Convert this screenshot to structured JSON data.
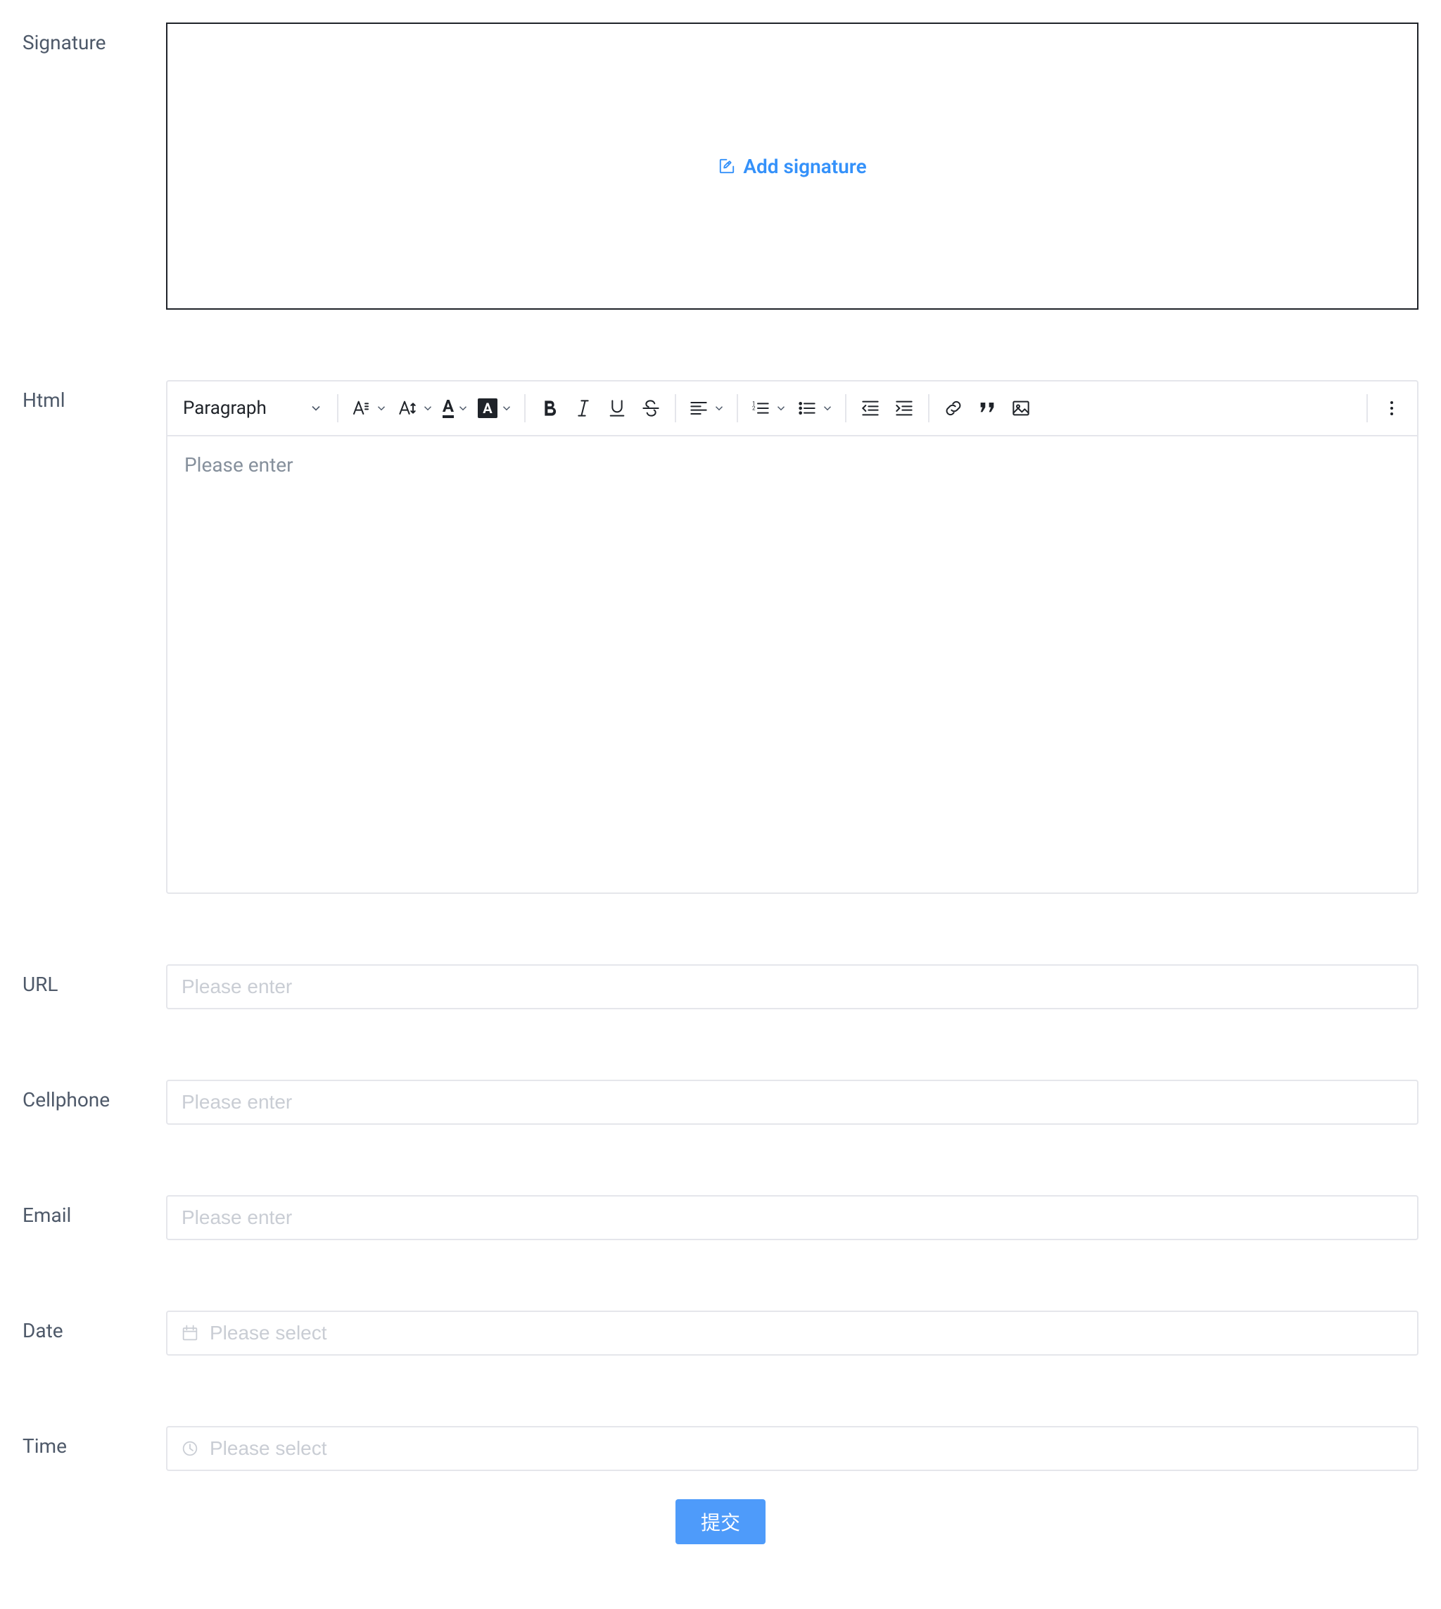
{
  "labels": {
    "signature": "Signature",
    "html": "Html",
    "url": "URL",
    "cellphone": "Cellphone",
    "email": "Email",
    "date": "Date",
    "time": "Time"
  },
  "signature": {
    "add_link": "Add signature"
  },
  "editor": {
    "paragraph_selector": "Paragraph",
    "body_placeholder": "Please enter"
  },
  "placeholders": {
    "url": "Please enter",
    "cellphone": "Please enter",
    "email": "Please enter",
    "date": "Please select",
    "time": "Please select"
  },
  "submit": {
    "label": "提交"
  }
}
